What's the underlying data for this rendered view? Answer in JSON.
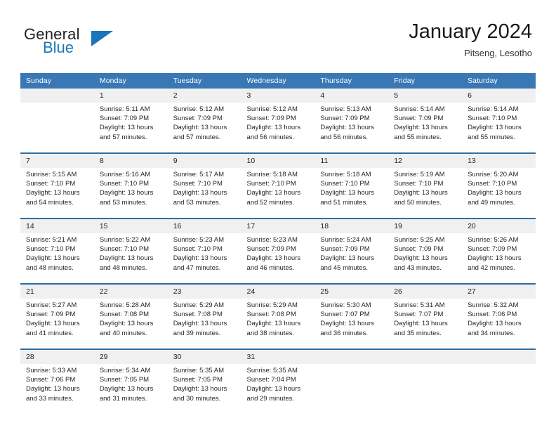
{
  "brand": {
    "word1": "General",
    "word2": "Blue",
    "flag_icon": "triangle-flag-icon",
    "color_primary": "#1b75bb",
    "color_text": "#231f20"
  },
  "header": {
    "title": "January 2024",
    "subtitle": "Pitseng, Lesotho"
  },
  "theme": {
    "header_row_bg": "#3a77b5",
    "daynum_bg": "#f0f0f0",
    "week_divider": "#2e6da4",
    "text": "#262626"
  },
  "weekdays": [
    "Sunday",
    "Monday",
    "Tuesday",
    "Wednesday",
    "Thursday",
    "Friday",
    "Saturday"
  ],
  "weeks": [
    [
      {
        "day": "",
        "sunrise": "",
        "sunset": "",
        "daylight1": "",
        "daylight2": ""
      },
      {
        "day": "1",
        "sunrise": "Sunrise: 5:11 AM",
        "sunset": "Sunset: 7:09 PM",
        "daylight1": "Daylight: 13 hours",
        "daylight2": "and 57 minutes."
      },
      {
        "day": "2",
        "sunrise": "Sunrise: 5:12 AM",
        "sunset": "Sunset: 7:09 PM",
        "daylight1": "Daylight: 13 hours",
        "daylight2": "and 57 minutes."
      },
      {
        "day": "3",
        "sunrise": "Sunrise: 5:12 AM",
        "sunset": "Sunset: 7:09 PM",
        "daylight1": "Daylight: 13 hours",
        "daylight2": "and 56 minutes."
      },
      {
        "day": "4",
        "sunrise": "Sunrise: 5:13 AM",
        "sunset": "Sunset: 7:09 PM",
        "daylight1": "Daylight: 13 hours",
        "daylight2": "and 56 minutes."
      },
      {
        "day": "5",
        "sunrise": "Sunrise: 5:14 AM",
        "sunset": "Sunset: 7:09 PM",
        "daylight1": "Daylight: 13 hours",
        "daylight2": "and 55 minutes."
      },
      {
        "day": "6",
        "sunrise": "Sunrise: 5:14 AM",
        "sunset": "Sunset: 7:10 PM",
        "daylight1": "Daylight: 13 hours",
        "daylight2": "and 55 minutes."
      }
    ],
    [
      {
        "day": "7",
        "sunrise": "Sunrise: 5:15 AM",
        "sunset": "Sunset: 7:10 PM",
        "daylight1": "Daylight: 13 hours",
        "daylight2": "and 54 minutes."
      },
      {
        "day": "8",
        "sunrise": "Sunrise: 5:16 AM",
        "sunset": "Sunset: 7:10 PM",
        "daylight1": "Daylight: 13 hours",
        "daylight2": "and 53 minutes."
      },
      {
        "day": "9",
        "sunrise": "Sunrise: 5:17 AM",
        "sunset": "Sunset: 7:10 PM",
        "daylight1": "Daylight: 13 hours",
        "daylight2": "and 53 minutes."
      },
      {
        "day": "10",
        "sunrise": "Sunrise: 5:18 AM",
        "sunset": "Sunset: 7:10 PM",
        "daylight1": "Daylight: 13 hours",
        "daylight2": "and 52 minutes."
      },
      {
        "day": "11",
        "sunrise": "Sunrise: 5:18 AM",
        "sunset": "Sunset: 7:10 PM",
        "daylight1": "Daylight: 13 hours",
        "daylight2": "and 51 minutes."
      },
      {
        "day": "12",
        "sunrise": "Sunrise: 5:19 AM",
        "sunset": "Sunset: 7:10 PM",
        "daylight1": "Daylight: 13 hours",
        "daylight2": "and 50 minutes."
      },
      {
        "day": "13",
        "sunrise": "Sunrise: 5:20 AM",
        "sunset": "Sunset: 7:10 PM",
        "daylight1": "Daylight: 13 hours",
        "daylight2": "and 49 minutes."
      }
    ],
    [
      {
        "day": "14",
        "sunrise": "Sunrise: 5:21 AM",
        "sunset": "Sunset: 7:10 PM",
        "daylight1": "Daylight: 13 hours",
        "daylight2": "and 48 minutes."
      },
      {
        "day": "15",
        "sunrise": "Sunrise: 5:22 AM",
        "sunset": "Sunset: 7:10 PM",
        "daylight1": "Daylight: 13 hours",
        "daylight2": "and 48 minutes."
      },
      {
        "day": "16",
        "sunrise": "Sunrise: 5:23 AM",
        "sunset": "Sunset: 7:10 PM",
        "daylight1": "Daylight: 13 hours",
        "daylight2": "and 47 minutes."
      },
      {
        "day": "17",
        "sunrise": "Sunrise: 5:23 AM",
        "sunset": "Sunset: 7:09 PM",
        "daylight1": "Daylight: 13 hours",
        "daylight2": "and 46 minutes."
      },
      {
        "day": "18",
        "sunrise": "Sunrise: 5:24 AM",
        "sunset": "Sunset: 7:09 PM",
        "daylight1": "Daylight: 13 hours",
        "daylight2": "and 45 minutes."
      },
      {
        "day": "19",
        "sunrise": "Sunrise: 5:25 AM",
        "sunset": "Sunset: 7:09 PM",
        "daylight1": "Daylight: 13 hours",
        "daylight2": "and 43 minutes."
      },
      {
        "day": "20",
        "sunrise": "Sunrise: 5:26 AM",
        "sunset": "Sunset: 7:09 PM",
        "daylight1": "Daylight: 13 hours",
        "daylight2": "and 42 minutes."
      }
    ],
    [
      {
        "day": "21",
        "sunrise": "Sunrise: 5:27 AM",
        "sunset": "Sunset: 7:09 PM",
        "daylight1": "Daylight: 13 hours",
        "daylight2": "and 41 minutes."
      },
      {
        "day": "22",
        "sunrise": "Sunrise: 5:28 AM",
        "sunset": "Sunset: 7:08 PM",
        "daylight1": "Daylight: 13 hours",
        "daylight2": "and 40 minutes."
      },
      {
        "day": "23",
        "sunrise": "Sunrise: 5:29 AM",
        "sunset": "Sunset: 7:08 PM",
        "daylight1": "Daylight: 13 hours",
        "daylight2": "and 39 minutes."
      },
      {
        "day": "24",
        "sunrise": "Sunrise: 5:29 AM",
        "sunset": "Sunset: 7:08 PM",
        "daylight1": "Daylight: 13 hours",
        "daylight2": "and 38 minutes."
      },
      {
        "day": "25",
        "sunrise": "Sunrise: 5:30 AM",
        "sunset": "Sunset: 7:07 PM",
        "daylight1": "Daylight: 13 hours",
        "daylight2": "and 36 minutes."
      },
      {
        "day": "26",
        "sunrise": "Sunrise: 5:31 AM",
        "sunset": "Sunset: 7:07 PM",
        "daylight1": "Daylight: 13 hours",
        "daylight2": "and 35 minutes."
      },
      {
        "day": "27",
        "sunrise": "Sunrise: 5:32 AM",
        "sunset": "Sunset: 7:06 PM",
        "daylight1": "Daylight: 13 hours",
        "daylight2": "and 34 minutes."
      }
    ],
    [
      {
        "day": "28",
        "sunrise": "Sunrise: 5:33 AM",
        "sunset": "Sunset: 7:06 PM",
        "daylight1": "Daylight: 13 hours",
        "daylight2": "and 33 minutes."
      },
      {
        "day": "29",
        "sunrise": "Sunrise: 5:34 AM",
        "sunset": "Sunset: 7:05 PM",
        "daylight1": "Daylight: 13 hours",
        "daylight2": "and 31 minutes."
      },
      {
        "day": "30",
        "sunrise": "Sunrise: 5:35 AM",
        "sunset": "Sunset: 7:05 PM",
        "daylight1": "Daylight: 13 hours",
        "daylight2": "and 30 minutes."
      },
      {
        "day": "31",
        "sunrise": "Sunrise: 5:35 AM",
        "sunset": "Sunset: 7:04 PM",
        "daylight1": "Daylight: 13 hours",
        "daylight2": "and 29 minutes."
      },
      {
        "day": "",
        "sunrise": "",
        "sunset": "",
        "daylight1": "",
        "daylight2": ""
      },
      {
        "day": "",
        "sunrise": "",
        "sunset": "",
        "daylight1": "",
        "daylight2": ""
      },
      {
        "day": "",
        "sunrise": "",
        "sunset": "",
        "daylight1": "",
        "daylight2": ""
      }
    ]
  ]
}
